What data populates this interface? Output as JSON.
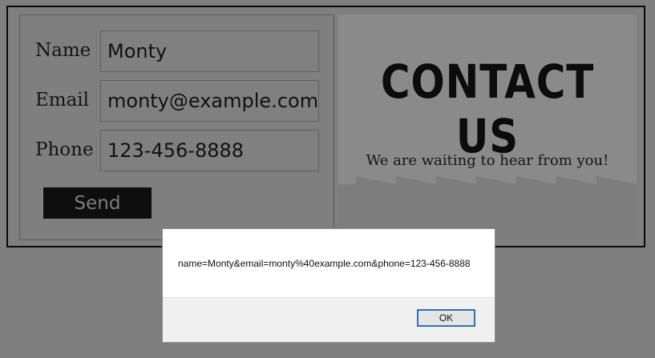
{
  "form": {
    "fields": [
      {
        "label": "Name",
        "value": "Monty"
      },
      {
        "label": "Email",
        "value": "monty@example.com"
      },
      {
        "label": "Phone",
        "value": "123-456-8888"
      }
    ],
    "send_label": "Send"
  },
  "contact": {
    "title": "CONTACT US",
    "subtitle": "We are waiting to hear from you!"
  },
  "dialog": {
    "message": "name=Monty&email=monty%40example.com&phone=123-456-8888",
    "ok_label": "OK"
  },
  "colors": {
    "overlay_background": "#7f7f7f",
    "dialog_button_border": "#2c73b8"
  }
}
